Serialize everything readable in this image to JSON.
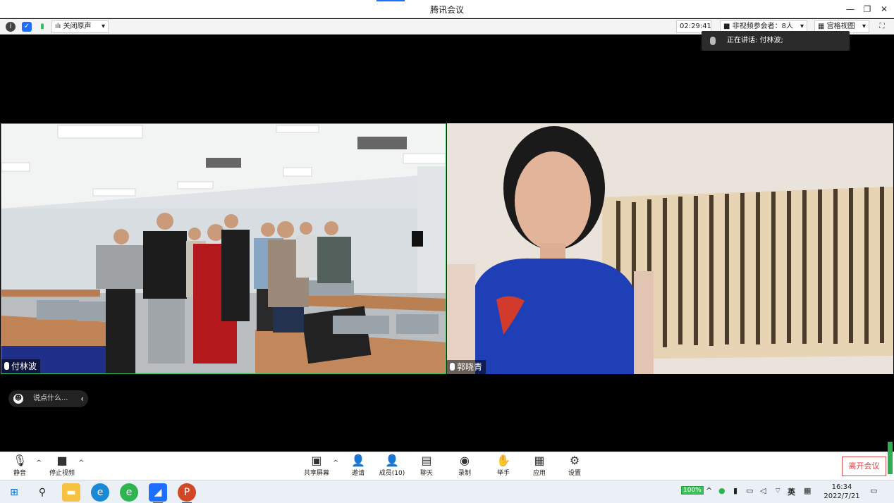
{
  "window": {
    "title": "腾讯会议"
  },
  "infobar": {
    "audio_label": "关闭原声",
    "timer": "02:29:41",
    "non_video": "非视频参会者：8人",
    "view_label": "宫格视图"
  },
  "speaking": {
    "label": "正在讲话: 付林波;"
  },
  "tiles": {
    "left_name": "付林波",
    "right_name": "郭晓青"
  },
  "chat": {
    "placeholder": "说点什么..."
  },
  "toolbar": {
    "mute": "静音",
    "stop_video": "停止视频",
    "share": "共享屏幕",
    "invite": "邀请",
    "members": "成员(10)",
    "chat": "聊天",
    "record": "录制",
    "raise_hand": "举手",
    "apps": "应用",
    "settings": "设置",
    "leave": "离开会议"
  },
  "taskbar": {
    "battery": "100%",
    "ime": "英",
    "time": "16:34",
    "date": "2022/7/21"
  },
  "colors": {
    "accent": "#1e6fff",
    "active_border": "#2cbf57",
    "leave": "#e04040"
  }
}
